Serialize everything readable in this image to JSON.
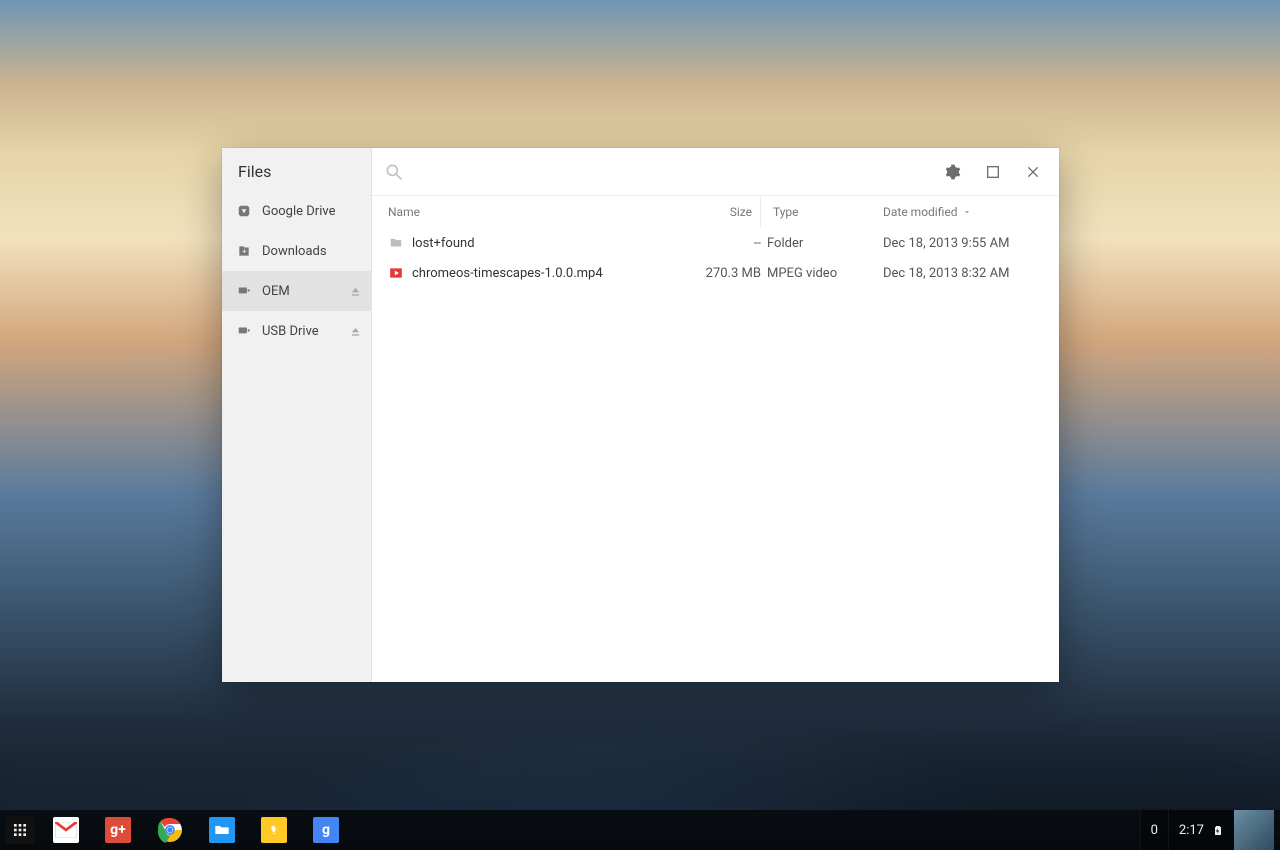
{
  "window": {
    "title": "Files"
  },
  "sidebar": {
    "items": [
      {
        "label": "Google Drive",
        "icon": "drive-icon",
        "ejectable": false,
        "active": false
      },
      {
        "label": "Downloads",
        "icon": "downloads-icon",
        "ejectable": false,
        "active": false
      },
      {
        "label": "OEM",
        "icon": "device-icon",
        "ejectable": true,
        "active": true
      },
      {
        "label": "USB Drive",
        "icon": "device-icon",
        "ejectable": true,
        "active": false
      }
    ]
  },
  "columns": {
    "name": "Name",
    "size": "Size",
    "type": "Type",
    "date": "Date modified"
  },
  "rows": [
    {
      "icon": "folder",
      "name": "lost+found",
      "size": "--",
      "type": "Folder",
      "date": "Dec 18, 2013 9:55 AM"
    },
    {
      "icon": "video",
      "name": "chromeos-timescapes-1.0.0.mp4",
      "size": "270.3 MB",
      "type": "MPEG video",
      "date": "Dec 18, 2013 8:32 AM"
    }
  ],
  "shelf": {
    "apps": [
      {
        "id": "launcher",
        "name": "App Launcher"
      },
      {
        "id": "gmail",
        "name": "Gmail"
      },
      {
        "id": "gplus",
        "name": "Google+"
      },
      {
        "id": "chrome",
        "name": "Chrome"
      },
      {
        "id": "files",
        "name": "Files"
      },
      {
        "id": "keep",
        "name": "Keep"
      },
      {
        "id": "gsearch",
        "name": "Google Search"
      }
    ],
    "gplus_glyph": "g+",
    "gsearch_glyph": "g"
  },
  "tray": {
    "notifications": "0",
    "clock": "2:17"
  }
}
